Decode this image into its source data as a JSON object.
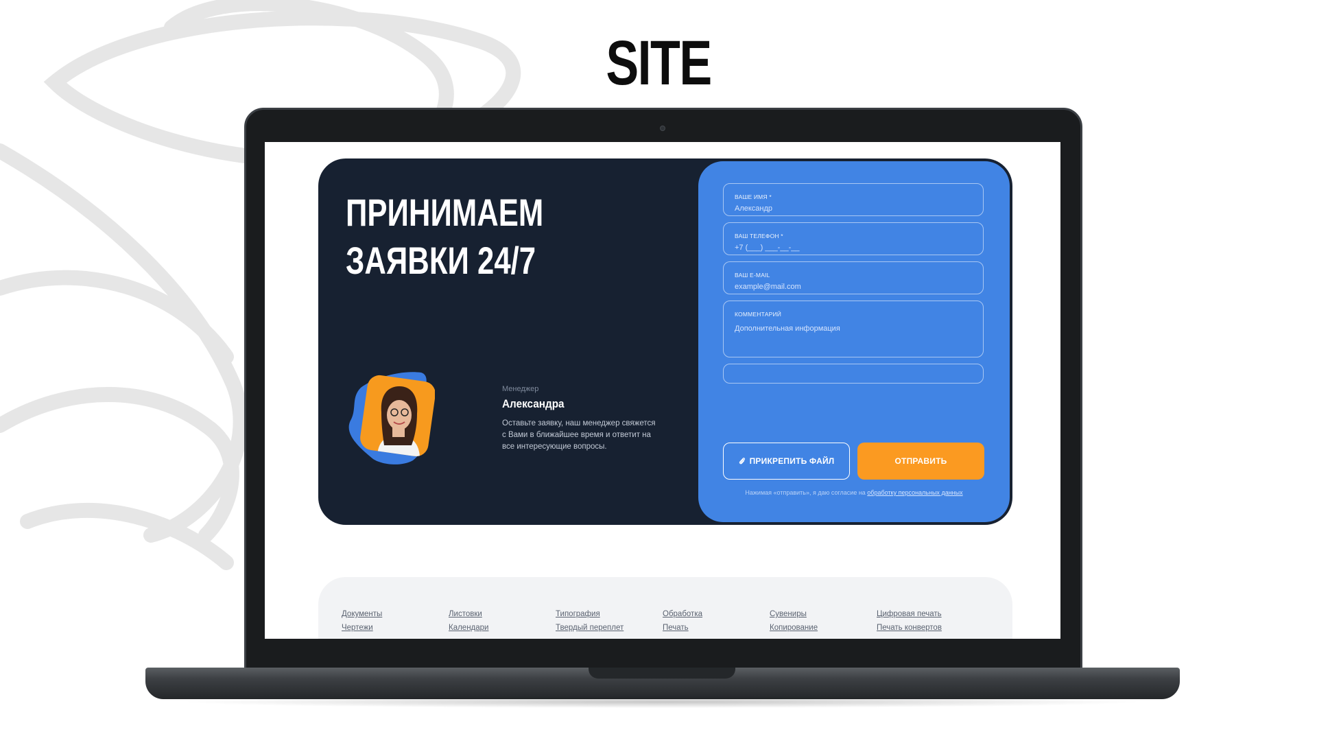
{
  "heading": "SITE",
  "card": {
    "title_line1": "ПРИНИМАЕМ",
    "title_line2": "ЗАЯВКИ 24/7",
    "manager": {
      "role": "Менеджер",
      "name": "Александра",
      "text": "Оставьте заявку, наш менеджер свяжется с Вами в ближайшее время и ответит на все интересующие вопросы."
    }
  },
  "form": {
    "name": {
      "label": "ВАШЕ ИМЯ *",
      "placeholder": "Александр"
    },
    "phone": {
      "label": "ВАШ ТЕЛЕФОН *",
      "placeholder": "+7 (___) ___-__-__"
    },
    "email": {
      "label": "ВАШ E-MAIL",
      "placeholder": "example@mail.com"
    },
    "comment": {
      "label": "КОММЕНТАРИЙ",
      "placeholder": "Дополнительная информация"
    },
    "extra_placeholder": "",
    "attach_label": "ПРИКРЕПИТЬ ФАЙЛ",
    "send_label": "ОТПРАВИТЬ",
    "consent_text": "Нажимая «отправить», я даю согласие на ",
    "consent_link": "обработку персональных данных"
  },
  "footer": {
    "columns": [
      [
        "Документы",
        "Чертежи"
      ],
      [
        "Листовки",
        "Календари"
      ],
      [
        "Типография",
        "Твердый переплет"
      ],
      [
        "Обработка",
        "Печать"
      ],
      [
        "Сувениры",
        "Копирование"
      ],
      [
        "Цифровая печать",
        "Печать конвертов"
      ]
    ]
  },
  "colors": {
    "card_bg": "#172131",
    "form_bg": "#4184e4",
    "accent": "#fb9a21",
    "footer_bg": "#f2f3f5"
  }
}
